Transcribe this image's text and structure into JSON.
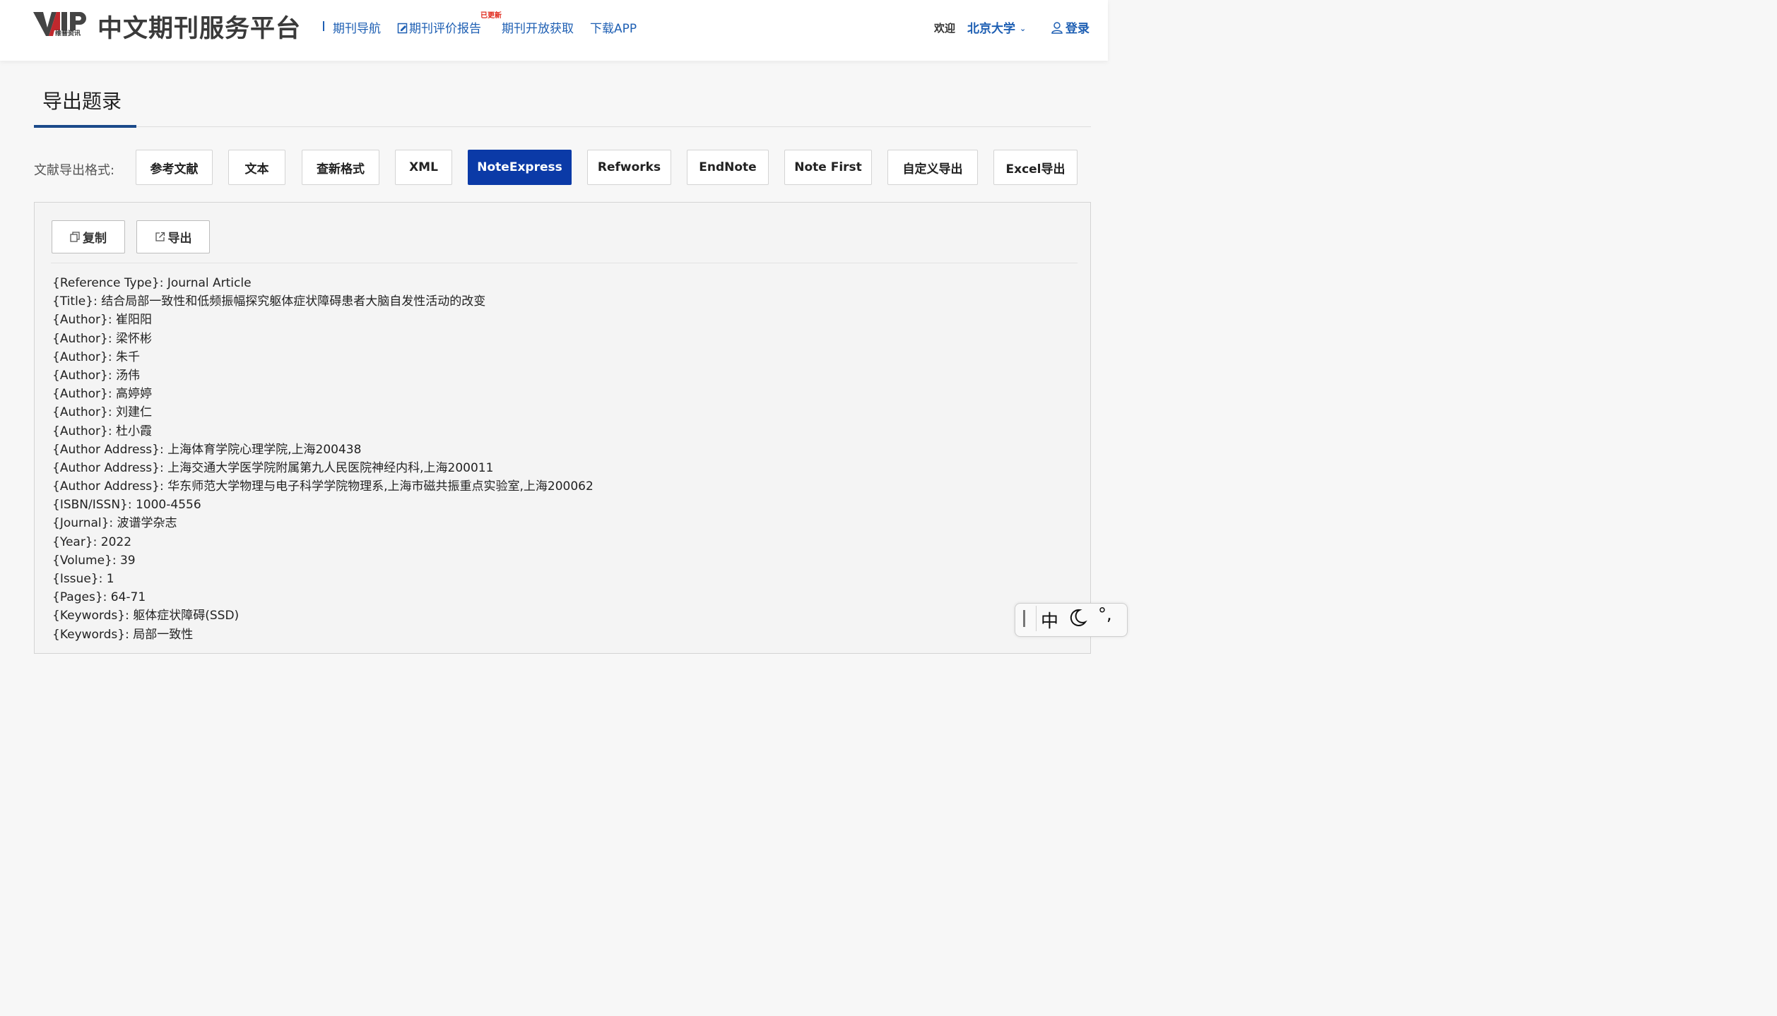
{
  "header": {
    "logo_text": "VIP",
    "logo_sub": "维普资讯",
    "platform_title": "中文期刊服务平台",
    "nav": [
      {
        "label": "期刊导航"
      },
      {
        "label": "期刊评价报告",
        "badge": "已更新"
      },
      {
        "label": "期刊开放获取"
      },
      {
        "label": "下载APP"
      }
    ],
    "welcome": "欢迎",
    "institution": "北京大学",
    "login": "登录"
  },
  "section_title": "导出题录",
  "format_bar": {
    "label": "文献导出格式:",
    "options": [
      "参考文献",
      "文本",
      "查新格式",
      "XML",
      "NoteExpress",
      "Refworks",
      "EndNote",
      "Note First",
      "自定义导出",
      "Excel导出"
    ],
    "selected": "NoteExpress"
  },
  "actions": {
    "copy": "复制",
    "export": "导出"
  },
  "reference_lines": [
    "{Reference Type}: Journal Article",
    "{Title}: 结合局部一致性和低频振幅探究躯体症状障碍患者大脑自发性活动的改变",
    "{Author}: 崔阳阳",
    "{Author}: 梁怀彬",
    "{Author}: 朱千",
    "{Author}: 汤伟",
    "{Author}: 高婷婷",
    "{Author}: 刘建仁",
    "{Author}: 杜小霞",
    "{Author Address}: 上海体育学院心理学院,上海200438",
    "{Author Address}: 上海交通大学医学院附属第九人民医院神经内科,上海200011",
    "{Author Address}: 华东师范大学物理与电子科学学院物理系,上海市磁共振重点实验室,上海200062",
    "{ISBN/ISSN}: 1000-4556",
    "{Journal}: 波谱学杂志",
    "{Year}: 2022",
    "{Volume}: 39",
    "{Issue}: 1",
    "{Pages}: 64-71",
    "{Keywords}: 躯体症状障碍(SSD)",
    "{Keywords}: 局部一致性"
  ],
  "ime": {
    "mode": "中",
    "punct": "°,"
  },
  "colors": {
    "brand_blue": "#1e5fb3",
    "active_format": "#0b3aa7",
    "badge_red": "#e0281b"
  }
}
